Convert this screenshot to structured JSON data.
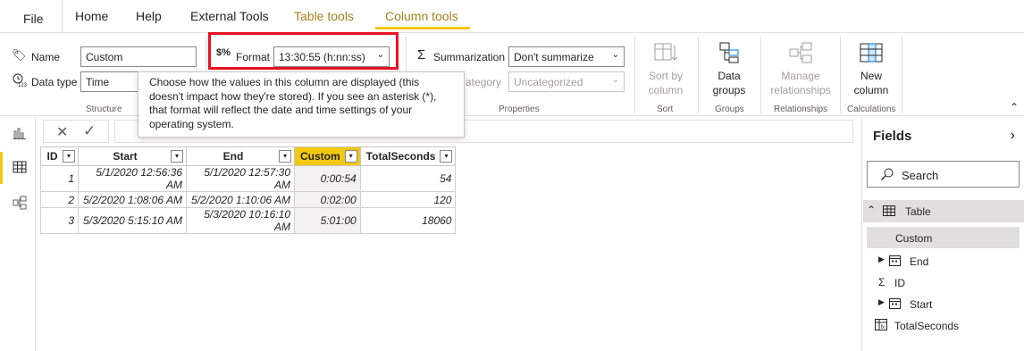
{
  "menu": {
    "file": "File",
    "home": "Home",
    "help": "Help",
    "external_tools": "External Tools",
    "table_tools": "Table tools",
    "column_tools": "Column tools"
  },
  "structure": {
    "name_label": "Name",
    "name_value": "Custom",
    "datatype_label": "Data type",
    "datatype_value": "Time",
    "group_label": "Structure"
  },
  "formatting": {
    "format_label": "Format",
    "format_value": "13:30:55 (h:nn:ss)"
  },
  "properties": {
    "summarization_label": "Summarization",
    "summarization_value": "Don't summarize",
    "category_label": "ategory",
    "category_value": "Uncategorized",
    "group_label": "Properties"
  },
  "sort": {
    "button_label": "Sort by column",
    "group_label": "Sort"
  },
  "groups": {
    "button_label": "Data groups",
    "group_label": "Groups"
  },
  "relationships": {
    "button_label": "Manage relationships",
    "group_label": "Relationships"
  },
  "calculations": {
    "button_label": "New column",
    "group_label": "Calculations"
  },
  "tooltip": {
    "text": "Choose how the values in this column are displayed (this doesn't impact how they're stored). If you see an asterisk (*), that format will reflect the date and time settings of your operating system."
  },
  "table": {
    "headers": [
      "ID",
      "Start",
      "End",
      "Custom",
      "TotalSeconds"
    ],
    "rows": [
      [
        "1",
        "5/1/2020 12:56:36 AM",
        "5/1/2020 12:57:30 AM",
        "0:00:54",
        "54"
      ],
      [
        "2",
        "5/2/2020 1:08:06 AM",
        "5/2/2020 1:10:06 AM",
        "0:02:00",
        "120"
      ],
      [
        "3",
        "5/3/2020 5:15:10 AM",
        "5/3/2020 10:16:10 AM",
        "5:01:00",
        "18060"
      ]
    ]
  },
  "fields_pane": {
    "title": "Fields",
    "search_placeholder": "Search",
    "table_name": "Table",
    "items": [
      "Custom",
      "End",
      "ID",
      "Start",
      "TotalSeconds"
    ]
  },
  "colors": {
    "accent": "#f2c811",
    "context_tab": "#a4821c",
    "highlight_border": "#e81123"
  }
}
